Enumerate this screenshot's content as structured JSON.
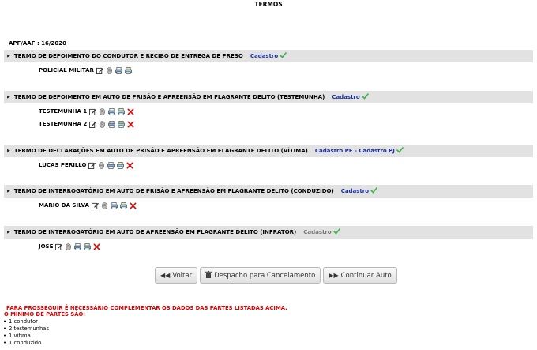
{
  "page_title": "TERMOS",
  "apf_label": "APF/AAF : 16/2020",
  "sections": [
    {
      "title": "TERMO DE DEPOIMENTO DO CONDUTOR E RECIBO DE ENTREGA DE PRESO",
      "links": [
        "Cadastro"
      ],
      "link_color": "blue",
      "parties": [
        {
          "name": "POLICIAL MILITAR",
          "icons": [
            "edit-icon",
            "fingerprint-icon",
            "print-icon",
            "print-copy-icon"
          ]
        }
      ]
    },
    {
      "title": "TERMO DE DEPOIMENTO EM AUTO DE PRISÃO E APREENSÃO EM FLAGRANTE DELITO (TESTEMUNHA)",
      "links": [
        "Cadastro"
      ],
      "link_color": "blue",
      "parties": [
        {
          "name": "TESTEMUNHA 1",
          "icons": [
            "edit-icon",
            "fingerprint-icon",
            "print-icon",
            "print-copy-icon",
            "delete-icon"
          ]
        },
        {
          "name": "TESTEMUNHA 2",
          "icons": [
            "edit-icon",
            "fingerprint-icon",
            "print-icon",
            "print-copy-icon",
            "delete-icon"
          ]
        }
      ]
    },
    {
      "title": "TERMO DE DECLARAÇÕES EM AUTO DE PRISÃO E APREENSÃO EM FLAGRANTE DELITO (VÍTIMA)",
      "links": [
        "Cadastro PF - Cadastro PJ"
      ],
      "link_color": "blue",
      "parties": [
        {
          "name": "LUCAS PERILLO",
          "icons": [
            "edit-icon",
            "fingerprint-icon",
            "print-icon",
            "print-copy-icon",
            "delete-icon"
          ]
        }
      ]
    },
    {
      "title": "TERMO DE INTERROGATÓRIO EM AUTO DE PRISÃO E APREENSÃO EM FLAGRANTE DELITO (CONDUZIDO)",
      "links": [
        "Cadastro"
      ],
      "link_color": "blue",
      "parties": [
        {
          "name": "MARIO DA SILVA",
          "icons": [
            "edit-icon",
            "fingerprint-icon",
            "print-icon",
            "print-copy-icon",
            "delete-icon"
          ]
        }
      ]
    },
    {
      "title": "TERMO DE INTERROGATÓRIO EM AUTO DE APREENSÃO EM FLAGRANTE DELITO (INFRATOR)",
      "links": [
        "Cadastro"
      ],
      "link_color": "grey",
      "parties": [
        {
          "name": "JOSE",
          "icons": [
            "edit-icon",
            "fingerprint-icon",
            "print-icon",
            "print-copy-icon",
            "delete-icon"
          ]
        }
      ]
    }
  ],
  "buttons": {
    "back": "Voltar",
    "cancel": "Despacho para Cancelamento",
    "continue": "Continuar Auto"
  },
  "warning": {
    "line1": "PARA PROSSEGUIR É NECESSÁRIO COMPLEMENTAR OS DADOS DAS PARTES LISTADAS ACIMA.",
    "line2": "O MÍNIMO DE PARTES SÃO:"
  },
  "requirements": [
    "1 condutor",
    "2 testemunhas",
    "1 vítima",
    "1 conduzido"
  ],
  "colors": {
    "link": "#1a2f9e",
    "check": "#39b54a",
    "warning": "#e00000",
    "delete": "#e00000",
    "header_bg": "#e2e2e2"
  }
}
